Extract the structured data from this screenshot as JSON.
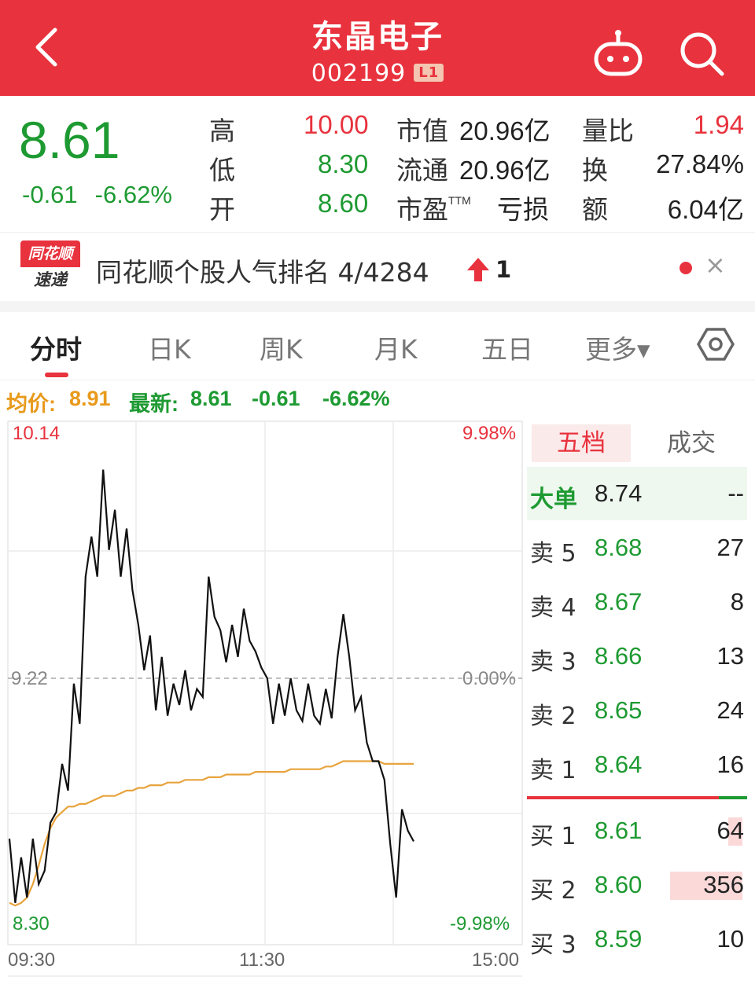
{
  "header": {
    "title": "东晶电子",
    "code": "002199",
    "badge": "L1"
  },
  "quote": {
    "price": "8.61",
    "change": "-0.61",
    "change_pct": "-6.62%",
    "high_label": "高",
    "high": "10.00",
    "low_label": "低",
    "low": "8.30",
    "open_label": "开",
    "open": "8.60",
    "mktcap_label": "市值",
    "mktcap": "20.96亿",
    "float_label": "流通",
    "float": "20.96亿",
    "pe_label": "市盈",
    "pe_sup": "TTM",
    "pe": "亏损",
    "vol_ratio_label": "量比",
    "vol_ratio": "1.94",
    "turnover_label": "换",
    "turnover": "27.84%",
    "amount_label": "额",
    "amount": "6.04亿"
  },
  "news": {
    "logo_top": "同花顺",
    "logo_bottom": "速递",
    "text": "同花顺个股人气排名 4/4284",
    "rank_change": "1"
  },
  "tabs": [
    {
      "label": "分时",
      "active": true
    },
    {
      "label": "日K"
    },
    {
      "label": "周K"
    },
    {
      "label": "月K"
    },
    {
      "label": "五日"
    },
    {
      "label": "更多▾"
    }
  ],
  "info": {
    "avg_label": "均价:",
    "avg": "8.91",
    "latest_label": "最新:",
    "latest": "8.61",
    "chg": "-0.61",
    "chg_pct": "-6.62%"
  },
  "chart_labels": {
    "top_price": "10.14",
    "top_pct": "9.98%",
    "mid_price": "9.22",
    "mid_pct": "0.00%",
    "bottom_price": "8.30",
    "bottom_pct": "-9.98%",
    "time_start": "09:30",
    "time_mid": "11:30",
    "time_end": "15:00"
  },
  "chart_data": {
    "type": "line",
    "ylim": [
      8.3,
      10.14
    ],
    "prev_close": 9.22,
    "series": [
      {
        "values": [
          8.62,
          8.38,
          8.55,
          8.4,
          8.62,
          8.45,
          8.5,
          8.68,
          8.72,
          8.9,
          8.8,
          9.2,
          9.05,
          9.6,
          9.75,
          9.6,
          10.0,
          9.7,
          9.85,
          9.6,
          9.78,
          9.55,
          9.42,
          9.25,
          9.38,
          9.1,
          9.3,
          9.08,
          9.2,
          9.12,
          9.25,
          9.1,
          9.18,
          9.15,
          9.6,
          9.45,
          9.4,
          9.28,
          9.42,
          9.3,
          9.48,
          9.36,
          9.32,
          9.26,
          9.22,
          9.05,
          9.2,
          9.08,
          9.22,
          9.1,
          9.06,
          9.2,
          9.08,
          9.05,
          9.18,
          9.07,
          9.3,
          9.46,
          9.3,
          9.1,
          9.15,
          8.98,
          8.91,
          8.91,
          8.84,
          8.6,
          8.4,
          8.73,
          8.65,
          8.61
        ]
      },
      {
        "values": [
          8.38,
          8.37,
          8.38,
          8.4,
          8.45,
          8.52,
          8.6,
          8.66,
          8.7,
          8.72,
          8.74,
          8.74,
          8.75,
          8.75,
          8.76,
          8.77,
          8.78,
          8.78,
          8.78,
          8.79,
          8.8,
          8.8,
          8.81,
          8.81,
          8.82,
          8.82,
          8.82,
          8.83,
          8.83,
          8.83,
          8.84,
          8.84,
          8.84,
          8.84,
          8.85,
          8.85,
          8.85,
          8.86,
          8.86,
          8.86,
          8.86,
          8.86,
          8.87,
          8.87,
          8.87,
          8.87,
          8.87,
          8.87,
          8.88,
          8.88,
          8.88,
          8.88,
          8.88,
          8.88,
          8.89,
          8.89,
          8.9,
          8.91,
          8.91,
          8.91,
          8.91,
          8.91,
          8.91,
          8.91,
          8.9,
          8.9,
          8.9,
          8.9,
          8.9,
          8.9
        ]
      }
    ],
    "x": [
      "09:30",
      "11:30",
      "15:00"
    ]
  },
  "orderbook": {
    "tab_active": "五档",
    "tab_other": "成交",
    "big_label": "大单",
    "big_price": "8.74",
    "big_vol": "--",
    "asks": [
      {
        "label": "卖 5",
        "price": "8.68",
        "vol": "27"
      },
      {
        "label": "卖 4",
        "price": "8.67",
        "vol": "8"
      },
      {
        "label": "卖 3",
        "price": "8.66",
        "vol": "13"
      },
      {
        "label": "卖 2",
        "price": "8.65",
        "vol": "24"
      },
      {
        "label": "卖 1",
        "price": "8.64",
        "vol": "16"
      }
    ],
    "bids": [
      {
        "label": "买 1",
        "price": "8.61",
        "vol": "64"
      },
      {
        "label": "买 2",
        "price": "8.60",
        "vol": "356"
      },
      {
        "label": "买 3",
        "price": "8.59",
        "vol": "10"
      }
    ]
  },
  "colors": {
    "brand_red": "#e8323d",
    "green": "#1e9a32",
    "avg_line": "#e8a33c"
  }
}
